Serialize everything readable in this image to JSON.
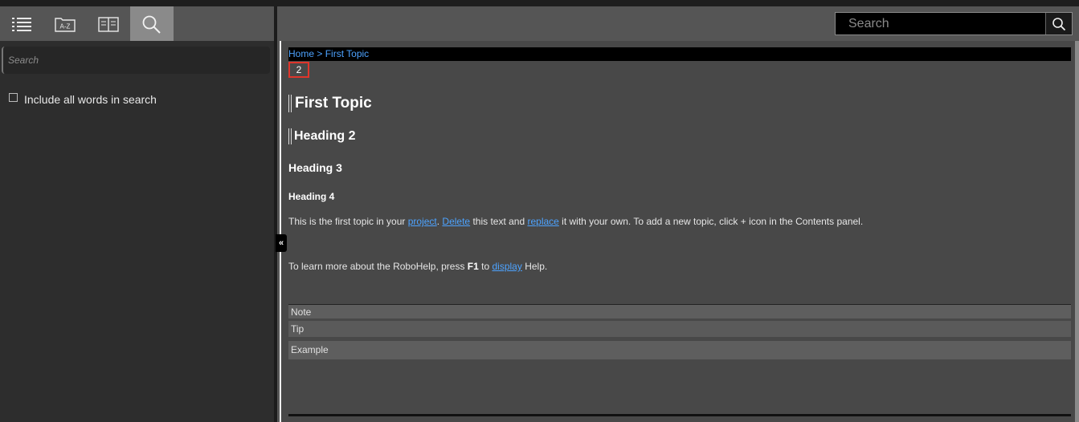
{
  "toolbar": {
    "tabs": [
      {
        "icon": "toc-list-icon",
        "active": false
      },
      {
        "icon": "az-index-icon",
        "label": "A-Z",
        "active": false
      },
      {
        "icon": "glossary-book-icon",
        "active": false
      },
      {
        "icon": "search-icon",
        "active": true
      }
    ]
  },
  "left_search": {
    "placeholder": "Search"
  },
  "options": {
    "include_all_words": "Include all words in search",
    "include_all_words_checked": false
  },
  "top_search": {
    "placeholder": "Search"
  },
  "collapse_toggle": "«",
  "topic": {
    "breadcrumb_home": "Home",
    "breadcrumb_sep": " > ",
    "breadcrumb_current": "First Topic",
    "page_number": "2",
    "h1": "First Topic",
    "h2": "Heading 2",
    "h3": "Heading 3",
    "h4": "Heading 4",
    "para1": {
      "t1": "This is the first topic in your ",
      "link_project": "project",
      "t2": ". ",
      "link_delete": "Delete",
      "t3": " this text and ",
      "link_replace": "replace",
      "t4": " it with your own. To add a new topic, click + icon in the Contents panel."
    },
    "para2": {
      "t1": "To learn more about the RoboHelp, press ",
      "key": "F1",
      "t2": " to ",
      "link_display": "display",
      "t3": " Help."
    },
    "note": "Note",
    "tip": "Tip",
    "example": "Example"
  },
  "colors": {
    "link": "#4da3ff",
    "highlight_border": "#e0352b",
    "active_tab": "#8a8a8a"
  }
}
